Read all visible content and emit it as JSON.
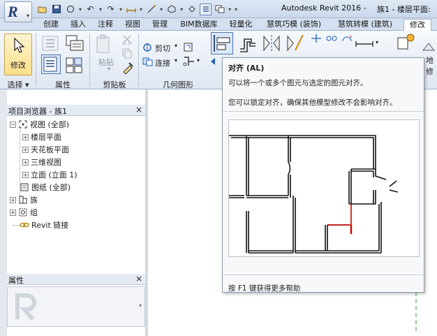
{
  "titlebar": {
    "app_title": "Autodesk Revit 2016 -",
    "doc_title": "族1 - 楼层平面:"
  },
  "ribbon_tabs": [
    {
      "label": "创建"
    },
    {
      "label": "插入"
    },
    {
      "label": "注释"
    },
    {
      "label": "视图"
    },
    {
      "label": "管理"
    },
    {
      "label": "BIM数据库"
    },
    {
      "label": "轻量化"
    },
    {
      "label": "慧筑巧模 (装饰)"
    },
    {
      "label": "慧筑转模 (建筑)"
    },
    {
      "label": "修改"
    }
  ],
  "ribbon": {
    "modify_label": "修改",
    "paste_label": "粘贴",
    "cut_label": "剪切",
    "join_label": "连接",
    "right_label_1": "地",
    "right_label_2": "修",
    "panels": {
      "select": "选择 ▾",
      "properties": "属性",
      "clipboard": "剪贴板",
      "geometry": "几何图形"
    }
  },
  "tooltip": {
    "title": "对齐 (AL)",
    "line1": "可以将一个或多个图元与选定的图元对齐。",
    "line2": "您可以锁定对齐，确保其他模型修改不会影响对齐。",
    "help": "按 F1 键获得更多帮助"
  },
  "project_browser": {
    "title": "项目浏览器 - 族1",
    "close": "×",
    "items": [
      {
        "label": "视图 (全部)"
      },
      {
        "label": "楼层平面"
      },
      {
        "label": "天花板平面"
      },
      {
        "label": "三维视图"
      },
      {
        "label": "立面 (立面 1)"
      },
      {
        "label": "图纸 (全部)"
      },
      {
        "label": "族"
      },
      {
        "label": "组"
      },
      {
        "label": "Revit 链接"
      }
    ]
  },
  "properties": {
    "title": "属性",
    "close": "×"
  },
  "colors": {
    "accent": "#4c74b0",
    "tab_bg": "#d4e0ef",
    "highlight_wall": "#d40000"
  }
}
